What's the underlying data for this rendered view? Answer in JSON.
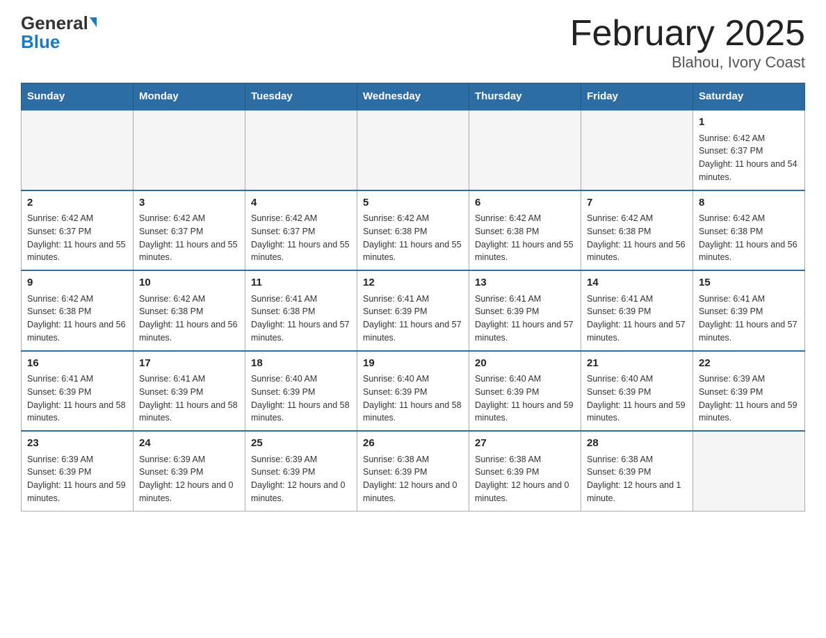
{
  "logo": {
    "general": "General",
    "blue": "Blue",
    "triangle": true
  },
  "title": "February 2025",
  "subtitle": "Blahou, Ivory Coast",
  "days_of_week": [
    "Sunday",
    "Monday",
    "Tuesday",
    "Wednesday",
    "Thursday",
    "Friday",
    "Saturday"
  ],
  "weeks": [
    [
      {
        "day": "",
        "info": ""
      },
      {
        "day": "",
        "info": ""
      },
      {
        "day": "",
        "info": ""
      },
      {
        "day": "",
        "info": ""
      },
      {
        "day": "",
        "info": ""
      },
      {
        "day": "",
        "info": ""
      },
      {
        "day": "1",
        "info": "Sunrise: 6:42 AM\nSunset: 6:37 PM\nDaylight: 11 hours and 54 minutes."
      }
    ],
    [
      {
        "day": "2",
        "info": "Sunrise: 6:42 AM\nSunset: 6:37 PM\nDaylight: 11 hours and 55 minutes."
      },
      {
        "day": "3",
        "info": "Sunrise: 6:42 AM\nSunset: 6:37 PM\nDaylight: 11 hours and 55 minutes."
      },
      {
        "day": "4",
        "info": "Sunrise: 6:42 AM\nSunset: 6:37 PM\nDaylight: 11 hours and 55 minutes."
      },
      {
        "day": "5",
        "info": "Sunrise: 6:42 AM\nSunset: 6:38 PM\nDaylight: 11 hours and 55 minutes."
      },
      {
        "day": "6",
        "info": "Sunrise: 6:42 AM\nSunset: 6:38 PM\nDaylight: 11 hours and 55 minutes."
      },
      {
        "day": "7",
        "info": "Sunrise: 6:42 AM\nSunset: 6:38 PM\nDaylight: 11 hours and 56 minutes."
      },
      {
        "day": "8",
        "info": "Sunrise: 6:42 AM\nSunset: 6:38 PM\nDaylight: 11 hours and 56 minutes."
      }
    ],
    [
      {
        "day": "9",
        "info": "Sunrise: 6:42 AM\nSunset: 6:38 PM\nDaylight: 11 hours and 56 minutes."
      },
      {
        "day": "10",
        "info": "Sunrise: 6:42 AM\nSunset: 6:38 PM\nDaylight: 11 hours and 56 minutes."
      },
      {
        "day": "11",
        "info": "Sunrise: 6:41 AM\nSunset: 6:38 PM\nDaylight: 11 hours and 57 minutes."
      },
      {
        "day": "12",
        "info": "Sunrise: 6:41 AM\nSunset: 6:39 PM\nDaylight: 11 hours and 57 minutes."
      },
      {
        "day": "13",
        "info": "Sunrise: 6:41 AM\nSunset: 6:39 PM\nDaylight: 11 hours and 57 minutes."
      },
      {
        "day": "14",
        "info": "Sunrise: 6:41 AM\nSunset: 6:39 PM\nDaylight: 11 hours and 57 minutes."
      },
      {
        "day": "15",
        "info": "Sunrise: 6:41 AM\nSunset: 6:39 PM\nDaylight: 11 hours and 57 minutes."
      }
    ],
    [
      {
        "day": "16",
        "info": "Sunrise: 6:41 AM\nSunset: 6:39 PM\nDaylight: 11 hours and 58 minutes."
      },
      {
        "day": "17",
        "info": "Sunrise: 6:41 AM\nSunset: 6:39 PM\nDaylight: 11 hours and 58 minutes."
      },
      {
        "day": "18",
        "info": "Sunrise: 6:40 AM\nSunset: 6:39 PM\nDaylight: 11 hours and 58 minutes."
      },
      {
        "day": "19",
        "info": "Sunrise: 6:40 AM\nSunset: 6:39 PM\nDaylight: 11 hours and 58 minutes."
      },
      {
        "day": "20",
        "info": "Sunrise: 6:40 AM\nSunset: 6:39 PM\nDaylight: 11 hours and 59 minutes."
      },
      {
        "day": "21",
        "info": "Sunrise: 6:40 AM\nSunset: 6:39 PM\nDaylight: 11 hours and 59 minutes."
      },
      {
        "day": "22",
        "info": "Sunrise: 6:39 AM\nSunset: 6:39 PM\nDaylight: 11 hours and 59 minutes."
      }
    ],
    [
      {
        "day": "23",
        "info": "Sunrise: 6:39 AM\nSunset: 6:39 PM\nDaylight: 11 hours and 59 minutes."
      },
      {
        "day": "24",
        "info": "Sunrise: 6:39 AM\nSunset: 6:39 PM\nDaylight: 12 hours and 0 minutes."
      },
      {
        "day": "25",
        "info": "Sunrise: 6:39 AM\nSunset: 6:39 PM\nDaylight: 12 hours and 0 minutes."
      },
      {
        "day": "26",
        "info": "Sunrise: 6:38 AM\nSunset: 6:39 PM\nDaylight: 12 hours and 0 minutes."
      },
      {
        "day": "27",
        "info": "Sunrise: 6:38 AM\nSunset: 6:39 PM\nDaylight: 12 hours and 0 minutes."
      },
      {
        "day": "28",
        "info": "Sunrise: 6:38 AM\nSunset: 6:39 PM\nDaylight: 12 hours and 1 minute."
      },
      {
        "day": "",
        "info": ""
      }
    ]
  ]
}
